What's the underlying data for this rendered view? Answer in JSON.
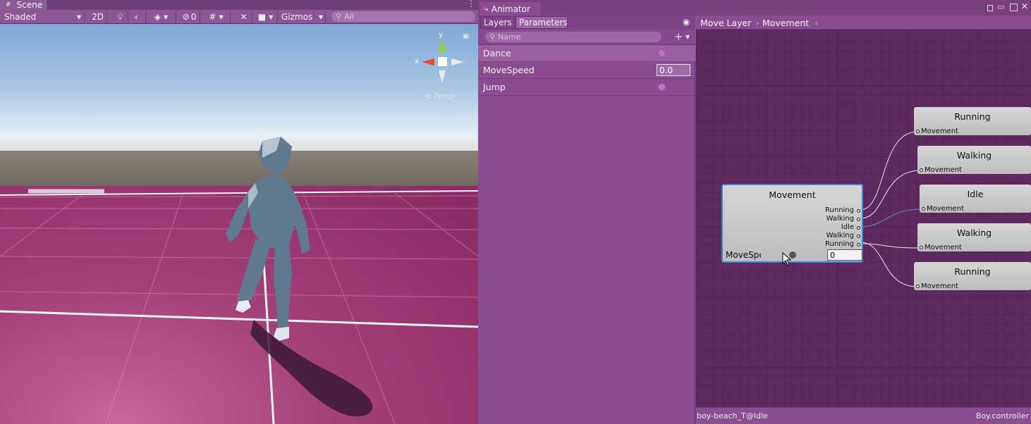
{
  "scene": {
    "tab_label": "Scene",
    "toolbar": {
      "shading_mode": "Shaded",
      "mode_2d_label": "2D",
      "hidden_count": "0",
      "gizmos_label": "Gizmos",
      "search_placeholder": "All"
    },
    "gizmo": {
      "y_label": "y",
      "x_label": "x",
      "projection_label": "Persp"
    }
  },
  "animator": {
    "tab_label": "Animator",
    "left_tabs": [
      "Layers",
      "Parameters"
    ],
    "param_search_placeholder": "Name",
    "parameters": [
      {
        "name": "Dance",
        "type": "trigger"
      },
      {
        "name": "MoveSpeed",
        "type": "float",
        "value": "0.0"
      },
      {
        "name": "Jump",
        "type": "trigger"
      }
    ],
    "breadcrumbs": [
      "Move Layer",
      "Movement"
    ],
    "blend_node": {
      "title": "Movement",
      "outputs": [
        "Running",
        "Walking",
        "Idle",
        "Walking",
        "Running"
      ],
      "param_label": "MoveSpeed",
      "param_value": "0"
    },
    "motion_nodes": [
      {
        "title": "Running",
        "port_label": "Movement"
      },
      {
        "title": "Walking",
        "port_label": "Movement"
      },
      {
        "title": "Idle",
        "port_label": "Movement"
      },
      {
        "title": "Walking",
        "port_label": "Movement"
      },
      {
        "title": "Running",
        "port_label": "Movement"
      }
    ],
    "status_left": "boy-beach_T@Idle",
    "status_right": "Boy.controller"
  },
  "colors": {
    "editor_tint": "#8a4d92",
    "graph_bg": "#5e2a5f",
    "selection_blue": "#3d86d8",
    "ground_pink": "#a4427a"
  }
}
